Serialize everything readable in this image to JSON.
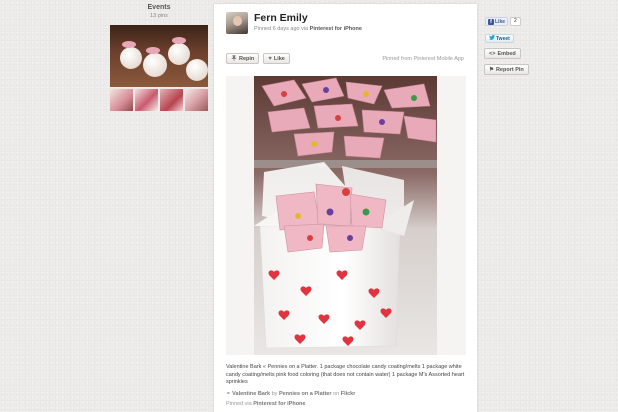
{
  "board": {
    "title": "Events",
    "count": "13 pins"
  },
  "pin": {
    "user_name": "Fern Emily",
    "pinned_ago": "Pinned 6 days ago via",
    "pinned_app": "Pinterest for iPhone",
    "repin_label": "Repin",
    "like_label": "Like",
    "pinned_from": "Pinned from Pinterest Mobile App",
    "description": "Valentine Bark « Pennies on a Platter. 1 package chocolate candy coating/melts 1 package white candy coating/melts pink food coloring (that does not contain water) 1 package M's Assorted heart sprinkles",
    "source_title": "Valentine Bark",
    "source_by": "by",
    "source_author": "Pennies on a Platter",
    "source_on": "on",
    "source_site": "Flickr",
    "pinned_via_label": "Pinned via",
    "pinned_via_app": "Pinterest for iPhone"
  },
  "sidebar": {
    "fb_like": "Like",
    "fb_count": "2",
    "tweet": "Tweet",
    "embed": "Embed",
    "report": "Report Pin"
  },
  "icons": {
    "repin": "pushpin-icon",
    "like": "heart-icon",
    "source": "link-icon",
    "embed": "code-icon",
    "report": "flag-icon",
    "facebook": "facebook-icon",
    "twitter": "twitter-icon"
  }
}
